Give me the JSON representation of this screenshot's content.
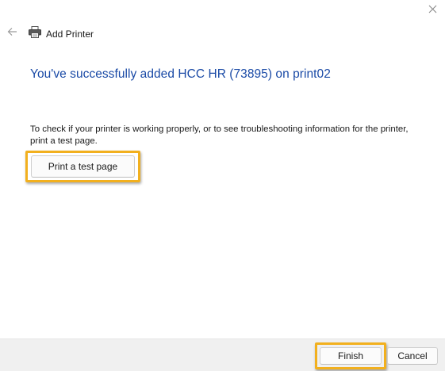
{
  "window": {
    "title": "Add Printer"
  },
  "main": {
    "heading": "You've successfully added HCC HR (73895) on print02",
    "description": "To check if your printer is working properly, or to see troubleshooting information for the printer, print a test page.",
    "test_page_label": "Print a test page"
  },
  "footer": {
    "finish_label": "Finish",
    "cancel_label": "Cancel"
  },
  "icons": {
    "close": "close-icon",
    "back": "back-arrow-icon",
    "printer": "printer-icon"
  },
  "colors": {
    "heading": "#1a4aa6",
    "highlight": "#f2b01e",
    "footer_bg": "#f0f0f0"
  }
}
